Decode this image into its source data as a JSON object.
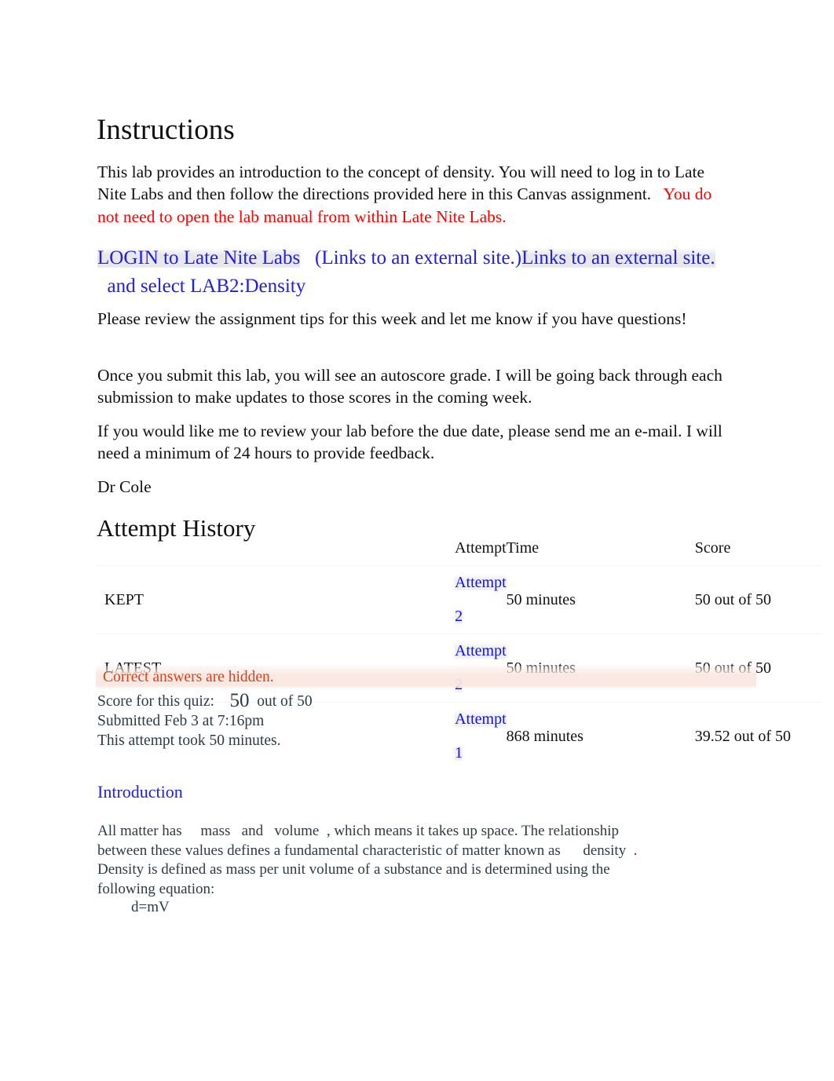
{
  "document": {
    "headings": {
      "instructions": "Instructions",
      "attempt_history": "Attempt History",
      "introduction": "Introduction"
    },
    "colors": {
      "link_blue": "#2020DD",
      "table_link_blue": "#1111EE",
      "warning_red": "#FF0000",
      "hidden_answers_orange": "#D8431C",
      "hidden_answers_band": "#FAE7E0",
      "canvas_slate": "#2D3B45",
      "body_black": "#111111",
      "page_background": "#FFFFFF"
    },
    "instructions": {
      "paragraph_1_plain": "This lab provides an introduction to the concept of density. You will need to log in to Late Nite Labs and then follow the directions provided here in this Canvas assignment. ",
      "paragraph_1_red": "You do not need to open the lab manual from within Late Nite Labs.",
      "login_link_text": "LOGIN to Late Nite Labs",
      "login_link_external_note": "(Links to an external site.)",
      "login_link_external_label": "Links to an external site.",
      "login_link_suffix": "and select LAB2:Density",
      "paragraph_tips": "Please review the assignment tips for this week and let me know if you have questions!",
      "paragraph_autoscore": "Once you submit this lab, you will see an autoscore grade. I will be going back through each submission to make updates to those scores in the coming week.",
      "paragraph_email": "If you would like me to review your lab before the due date, please send me an e-mail. I will need a minimum of 24 hours to provide feedback.",
      "signature": "Dr Cole"
    },
    "attempt_history": {
      "columns": [
        "",
        "Attempt",
        "Time",
        "Score"
      ],
      "rows": [
        {
          "label": "KEPT",
          "attempt": "Attempt 2",
          "time": "50 minutes",
          "score": "50 out of 50"
        },
        {
          "label": "LATEST",
          "attempt": "Attempt 2",
          "time": "50 minutes",
          "score": "50 out of 50"
        },
        {
          "label": "",
          "attempt": "Attempt 1",
          "time": "868 minutes",
          "score": "39.52 out of 50"
        }
      ]
    },
    "submission_summary": {
      "hidden_answers_notice": "Correct answers are hidden.",
      "score_label": "Score for this quiz:",
      "score_value": "50",
      "score_out_of": "out of 50",
      "submitted": "Submitted Feb 3 at 7:16pm",
      "duration": "This attempt took 50 minutes."
    },
    "introduction": {
      "sentence_a": "All matter has",
      "term_mass": "mass",
      "conjunction": "and",
      "term_volume": "volume",
      "sentence_b": ", which means it takes up space. The relationship between these values defines a fundamental characteristic of matter known as",
      "term_density": "density",
      "sentence_c": ". Density is defined as mass per unit volume of a substance and is determined using the following equation:",
      "equation": "d=mV"
    }
  }
}
